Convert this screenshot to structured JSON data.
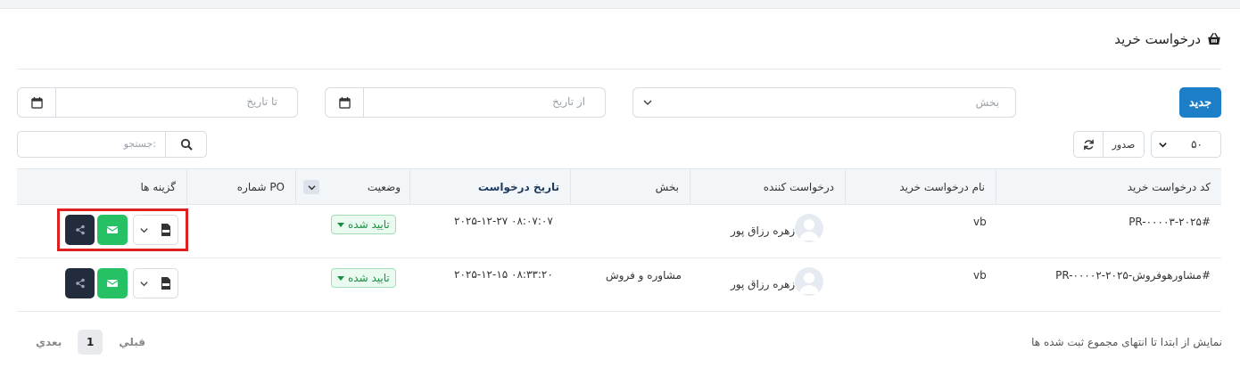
{
  "page": {
    "title": "درخواست خرید",
    "title_icon": "basket-icon"
  },
  "toolbar": {
    "new_label": "جدید",
    "section_placeholder": "بخش",
    "from_date_placeholder": "از تاریخ",
    "to_date_placeholder": "تا تاریخ",
    "page_size": "۵۰",
    "export_label": "صدور",
    "search_placeholder": "جستجو:"
  },
  "table": {
    "columns": [
      "کد درخواست خرید",
      "نام درخواست خرید",
      "درخواست کننده",
      "بخش",
      "تاریخ درخواست",
      "وضعیت",
      "شماره PO",
      "گزینه ها"
    ],
    "sorted_column": "تاریخ درخواست",
    "rows": [
      {
        "code": "PR-۰۰۰۰۳-۲۰۲۵#",
        "name": "vb",
        "requester": "زهره رزاق پور",
        "section": "",
        "date": "۲۰۲۵-۱۲-۲۷ ۰۸:۰۷:۰۷",
        "status": "تایید شده",
        "po": ""
      },
      {
        "code": "PR-۰۰۰۰۲-۲۰۲۵-مشاورهوفروش#",
        "name": "vb",
        "requester": "زهره رزاق پور",
        "section": "مشاوره و فروش",
        "date": "۲۰۲۵-۱۲-۱۵ ۰۸:۳۳:۲۰",
        "status": "تایید شده",
        "po": ""
      }
    ]
  },
  "footer": {
    "info": "نمایش از ابتدا تا انتهای مجموع ثبت شده ها",
    "prev_label": "قبلي",
    "next_label": "بعدي",
    "current_page": "1"
  },
  "colors": {
    "accent": "#1d7ec8",
    "success": "#26c165",
    "dark": "#232c3d",
    "highlight": "#e02020"
  }
}
